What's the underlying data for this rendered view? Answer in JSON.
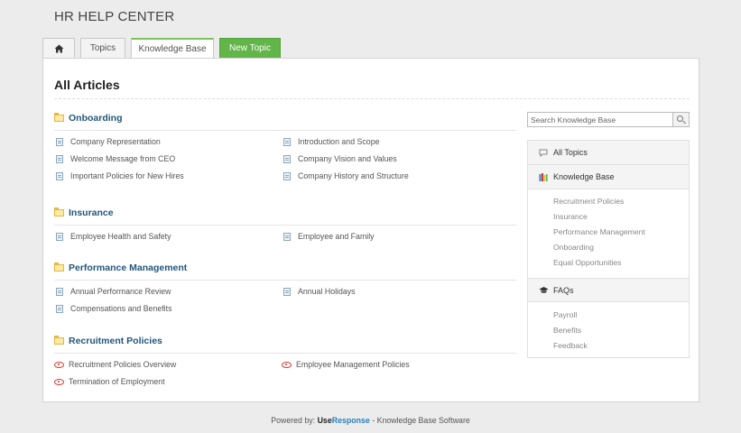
{
  "header": {
    "title": "HR HELP CENTER"
  },
  "tabs": {
    "topics": "Topics",
    "knowledge_base": "Knowledge Base",
    "new_topic": "New Topic"
  },
  "main": {
    "title": "All Articles",
    "sections": [
      {
        "title": "Onboarding",
        "articles": [
          "Company Representation",
          "Introduction and Scope",
          "Welcome Message from CEO",
          "Company Vision and Values",
          "Important Policies for New Hires",
          "Company History and Structure"
        ]
      },
      {
        "title": "Insurance",
        "articles": [
          "Employee Health and Safety",
          "Employee and Family"
        ]
      },
      {
        "title": "Performance Management",
        "articles": [
          "Annual Performance Review",
          "Annual Holidays",
          "Compensations and Benefits"
        ]
      },
      {
        "title": "Recruitment Policies",
        "articles": [
          "Recruitment Policies Overview",
          "Employee Management Policies",
          "Termination of Employment"
        ]
      }
    ]
  },
  "search": {
    "placeholder": "Search Knowledge Base"
  },
  "sidebar": {
    "all_topics": "All Topics",
    "knowledge_base": "Knowledge Base",
    "kb_links": [
      "Recruitment Policies",
      "Insurance",
      "Performance Management",
      "Onboarding",
      "Equal Opportunities"
    ],
    "faqs": "FAQs",
    "faq_links": [
      "Payroll",
      "Benefits",
      "Feedback"
    ]
  },
  "footer": {
    "prefix": "Powered by:",
    "brand_a": "Use",
    "brand_b": "Response",
    "suffix": " - Knowledge Base Software"
  },
  "colors": {
    "accent_green": "#62b548",
    "section_title": "#22577a",
    "eye_red": "#d9342b"
  }
}
